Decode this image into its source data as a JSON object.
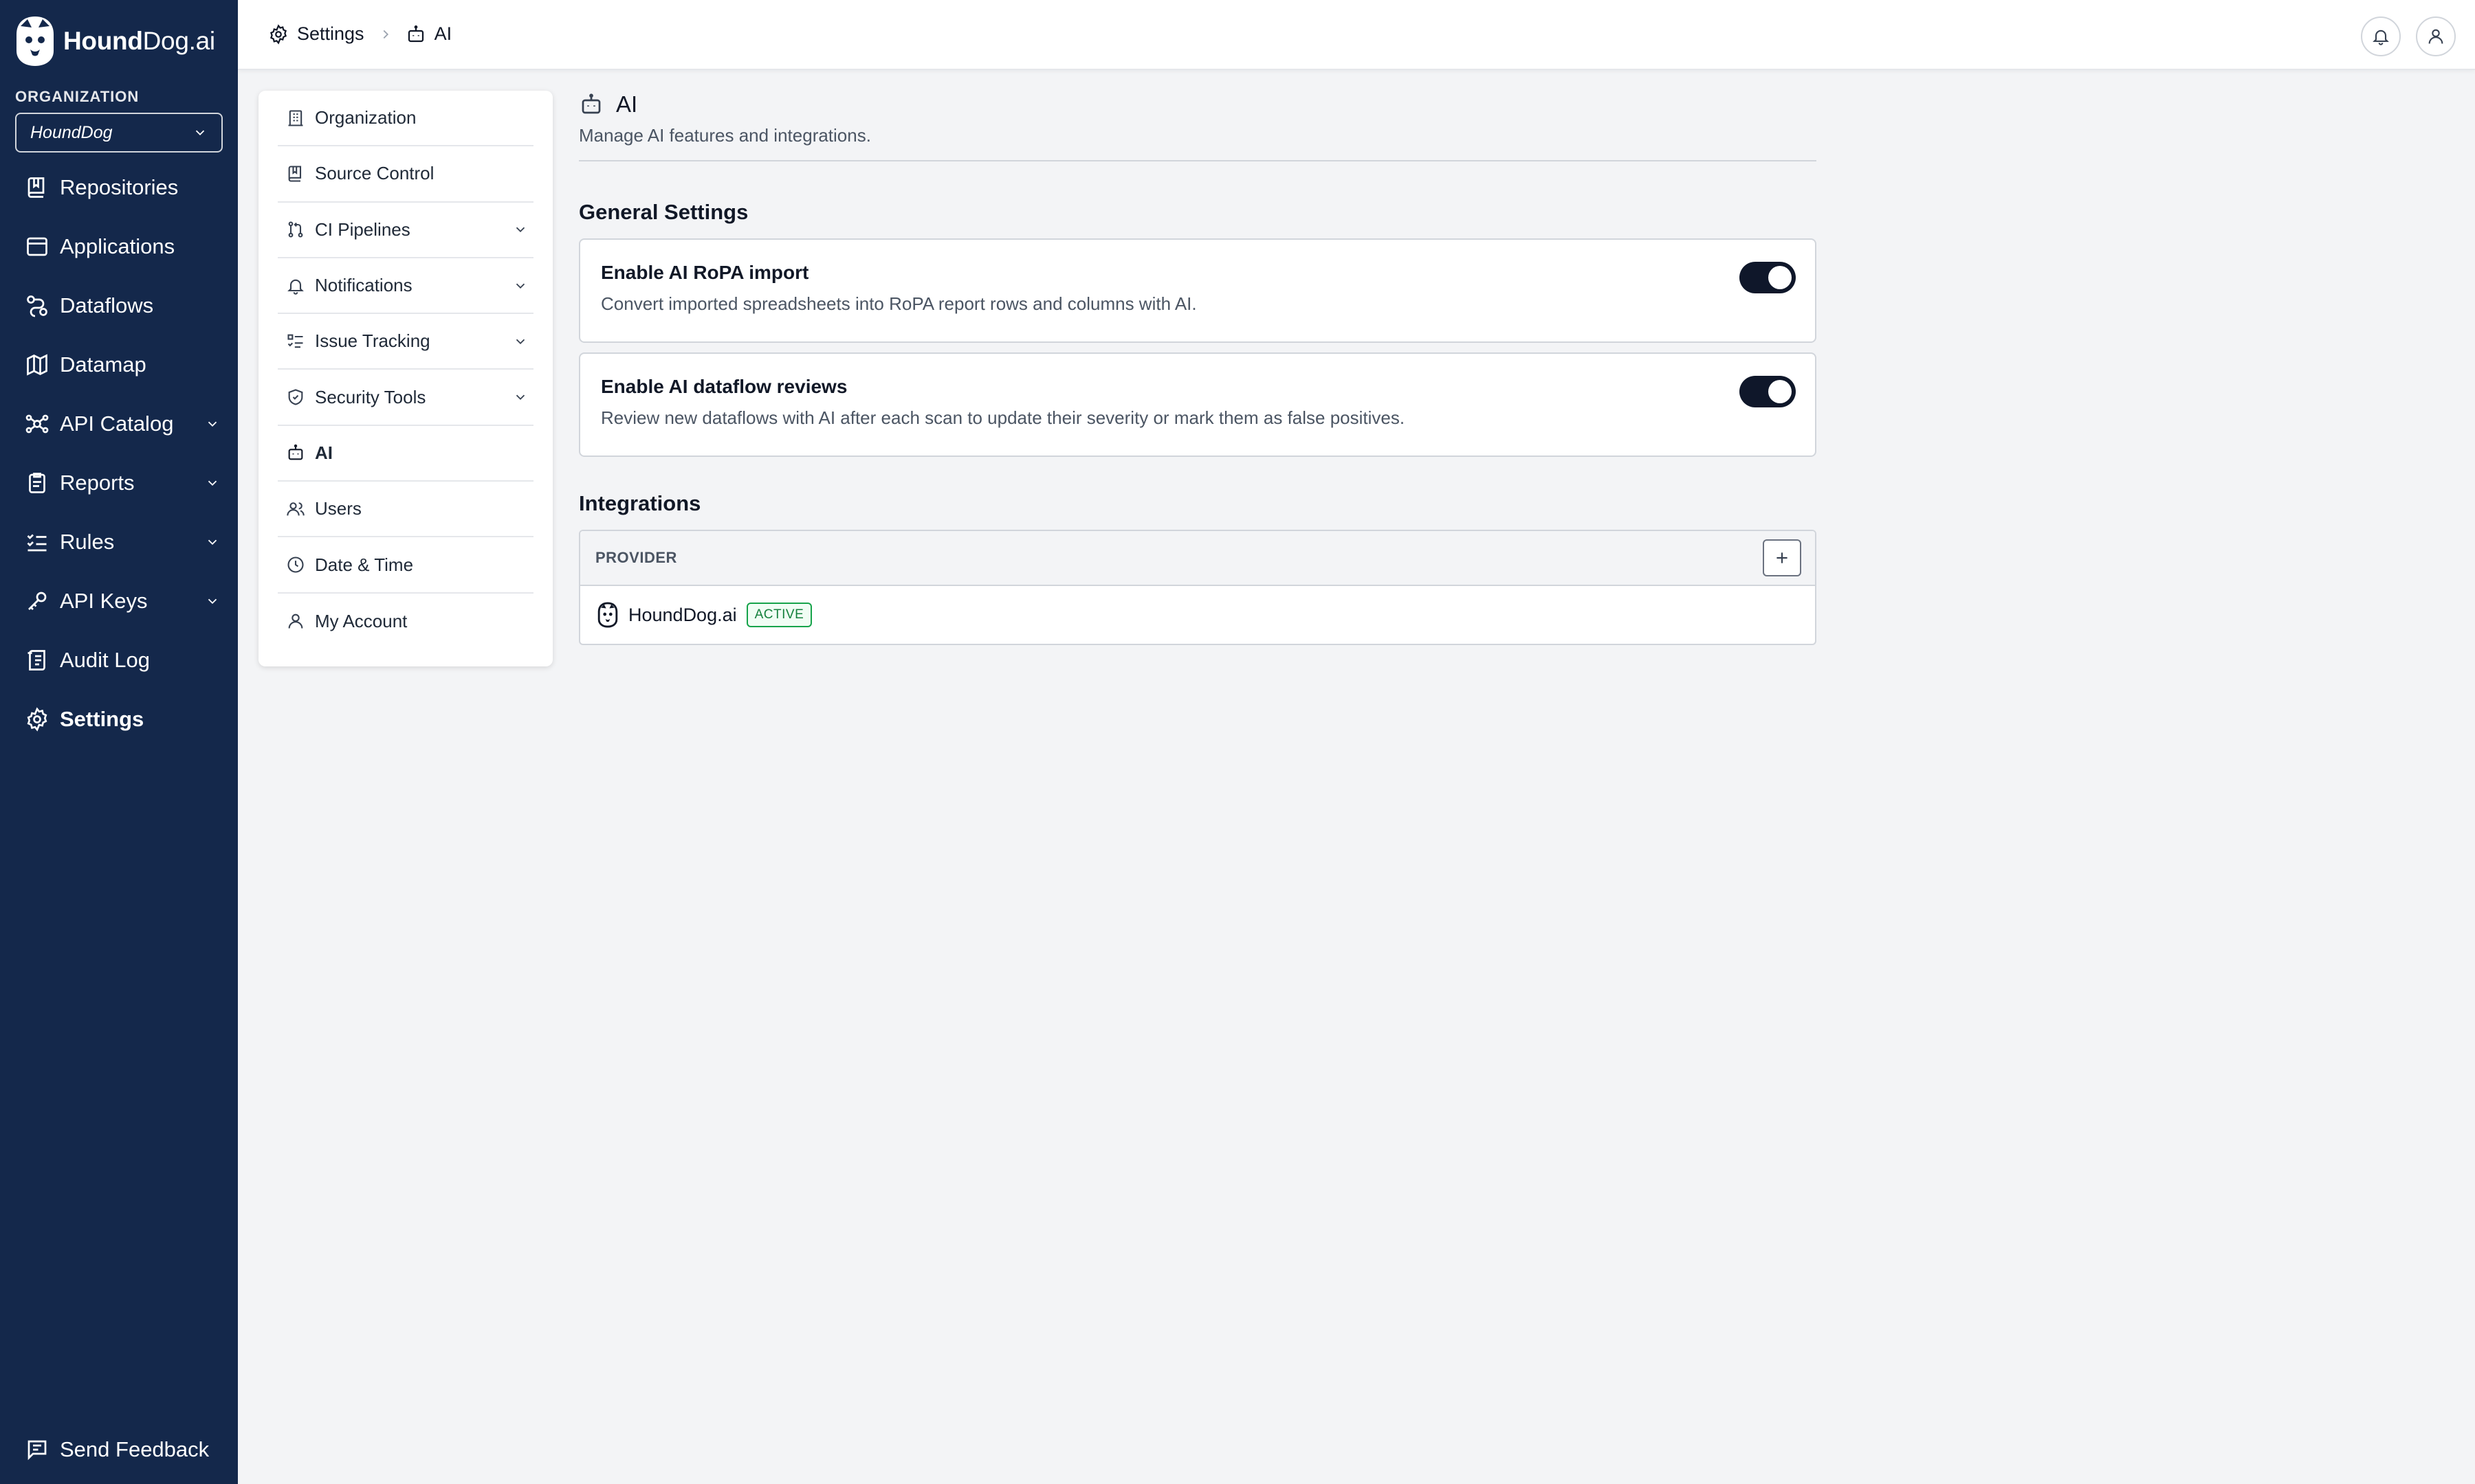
{
  "app": {
    "brand_bold": "Hound",
    "brand_rest": "Dog.ai"
  },
  "sidebar": {
    "org_label": "ORGANIZATION",
    "org_value": "HoundDog",
    "items": [
      {
        "label": "Repositories",
        "icon": "repository-icon"
      },
      {
        "label": "Applications",
        "icon": "application-icon"
      },
      {
        "label": "Dataflows",
        "icon": "dataflow-icon"
      },
      {
        "label": "Datamap",
        "icon": "map-icon"
      },
      {
        "label": "API Catalog",
        "icon": "api-catalog-icon"
      },
      {
        "label": "Reports",
        "icon": "report-icon"
      },
      {
        "label": "Rules",
        "icon": "rules-icon"
      },
      {
        "label": "API Keys",
        "icon": "key-icon"
      },
      {
        "label": "Audit Log",
        "icon": "audit-log-icon"
      },
      {
        "label": "Settings",
        "icon": "gear-icon"
      }
    ],
    "feedback_label": "Send Feedback"
  },
  "header": {
    "breadcrumb_settings": "Settings",
    "breadcrumb_ai": "AI"
  },
  "settings_menu": {
    "items": [
      {
        "label": "Organization",
        "icon": "building-icon"
      },
      {
        "label": "Source Control",
        "icon": "source-control-icon"
      },
      {
        "label": "CI Pipelines",
        "icon": "pipeline-icon"
      },
      {
        "label": "Notifications",
        "icon": "bell-icon"
      },
      {
        "label": "Issue Tracking",
        "icon": "issue-list-icon"
      },
      {
        "label": "Security Tools",
        "icon": "shield-icon"
      },
      {
        "label": "AI",
        "icon": "robot-icon"
      },
      {
        "label": "Users",
        "icon": "users-icon"
      },
      {
        "label": "Date & Time",
        "icon": "clock-icon"
      },
      {
        "label": "My Account",
        "icon": "user-icon"
      }
    ]
  },
  "main": {
    "title": "AI",
    "description": "Manage AI features and integrations.",
    "general_settings_title": "General Settings",
    "settings": [
      {
        "title": "Enable AI RoPA import",
        "description": "Convert imported spreadsheets into RoPA report rows and columns with AI.",
        "enabled": true
      },
      {
        "title": "Enable AI dataflow reviews",
        "description": "Review new dataflows with AI after each scan to update their severity or mark them as false positives.",
        "enabled": true
      }
    ],
    "integrations_title": "Integrations",
    "table": {
      "column_provider": "PROVIDER",
      "rows": [
        {
          "provider": "HoundDog.ai",
          "status": "ACTIVE"
        }
      ]
    }
  },
  "colors": {
    "sidebar_bg": "#14284b",
    "toggle_on": "#0f172a",
    "badge_green": "#16a34a"
  }
}
